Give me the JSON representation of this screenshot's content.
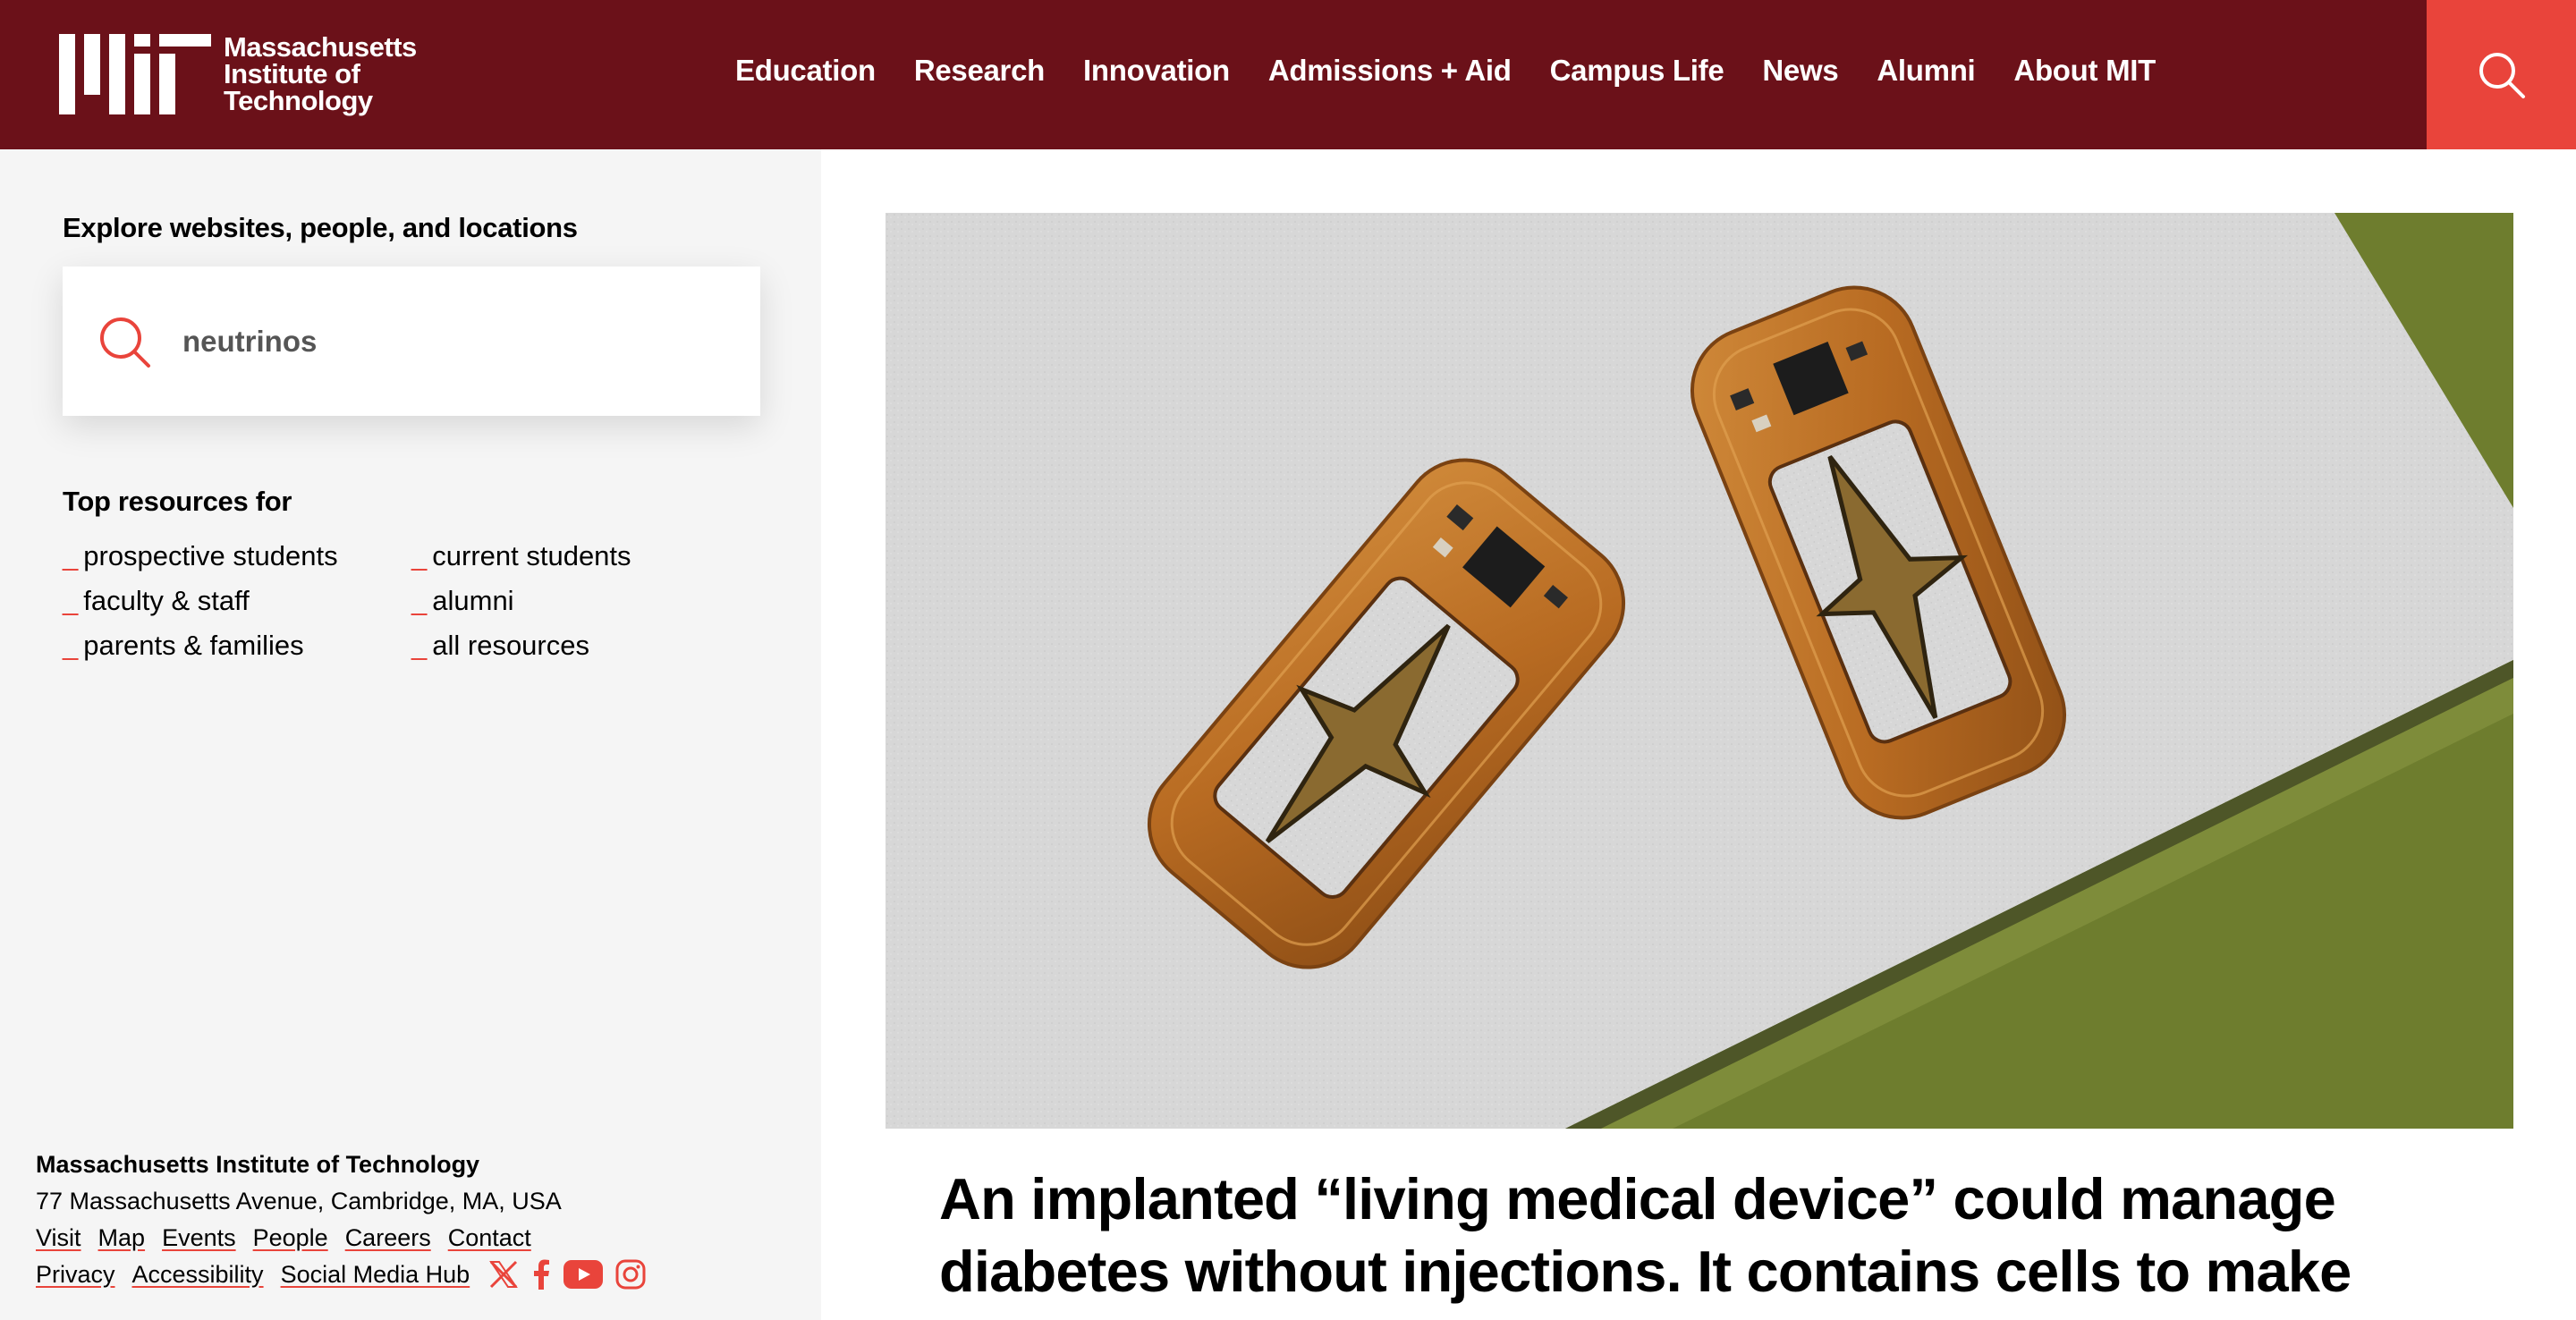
{
  "header": {
    "logo_lines": [
      "Massachusetts",
      "Institute of",
      "Technology"
    ],
    "nav": [
      "Education",
      "Research",
      "Innovation",
      "Admissions + Aid",
      "Campus Life",
      "News",
      "Alumni",
      "About MIT"
    ],
    "search_icon": "search-icon",
    "accent_color": "#e9443b",
    "header_color": "#6b1119"
  },
  "sidebar": {
    "explore_label": "Explore websites, people, and locations",
    "search_value": "neutrinos",
    "top_resources_label": "Top resources for",
    "resources": [
      "prospective students",
      "current students",
      "faculty & staff",
      "alumni",
      "parents & families",
      "all resources"
    ],
    "footer": {
      "title": "Massachusetts Institute of Technology",
      "address": "77 Massachusetts Avenue, Cambridge, MA, USA",
      "links_row1": [
        "Visit",
        "Map",
        "Events",
        "People",
        "Careers",
        "Contact"
      ],
      "links_row2": [
        "Privacy",
        "Accessibility",
        "Social Media Hub"
      ],
      "social_icons": [
        "x-icon",
        "facebook-icon",
        "youtube-icon",
        "instagram-icon"
      ]
    }
  },
  "main": {
    "headline": "An implanted “living medical device” could manage diabetes without injections. It contains cells to make"
  }
}
